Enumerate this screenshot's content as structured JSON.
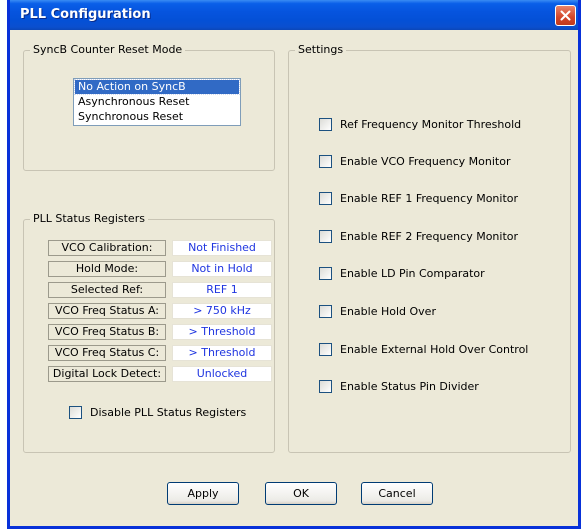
{
  "window": {
    "title": "PLL Configuration"
  },
  "syncb": {
    "label": "SyncB Counter Reset Mode",
    "options": [
      "No Action on SyncB",
      "Asynchronous Reset",
      "Synchronous Reset"
    ],
    "selected_index": 0
  },
  "status": {
    "label": "PLL Status Registers",
    "rows": [
      {
        "label": "VCO Calibration:",
        "value": "Not Finished"
      },
      {
        "label": "Hold Mode:",
        "value": "Not in Hold"
      },
      {
        "label": "Selected Ref:",
        "value": "REF 1"
      },
      {
        "label": "VCO Freq Status A:",
        "value": "> 750 kHz"
      },
      {
        "label": "VCO Freq Status B:",
        "value": "> Threshold"
      },
      {
        "label": "VCO Freq Status C:",
        "value": "> Threshold"
      },
      {
        "label": "Digital Lock Detect:",
        "value": "Unlocked"
      }
    ],
    "disable_label": "Disable PLL Status Registers",
    "disable_checked": false
  },
  "settings": {
    "label": "Settings",
    "checkboxes": [
      {
        "label": "Ref Frequency Monitor Threshold",
        "checked": false
      },
      {
        "label": "Enable VCO Frequency Monitor",
        "checked": false
      },
      {
        "label": "Enable REF 1 Frequency Monitor",
        "checked": false
      },
      {
        "label": "Enable REF 2 Frequency Monitor",
        "checked": false
      },
      {
        "label": "Enable LD Pin Comparator",
        "checked": false
      },
      {
        "label": "Enable Hold Over",
        "checked": false
      },
      {
        "label": "Enable External Hold Over Control",
        "checked": false
      },
      {
        "label": "Enable Status Pin Divider",
        "checked": false
      }
    ]
  },
  "buttons": {
    "apply": "Apply",
    "ok": "OK",
    "cancel": "Cancel"
  },
  "colors": {
    "titlebar": "#0654de",
    "value_text": "#1f35e0",
    "selection": "#316ac5",
    "close": "#d3452a"
  },
  "icons": {
    "close": "close-icon"
  }
}
